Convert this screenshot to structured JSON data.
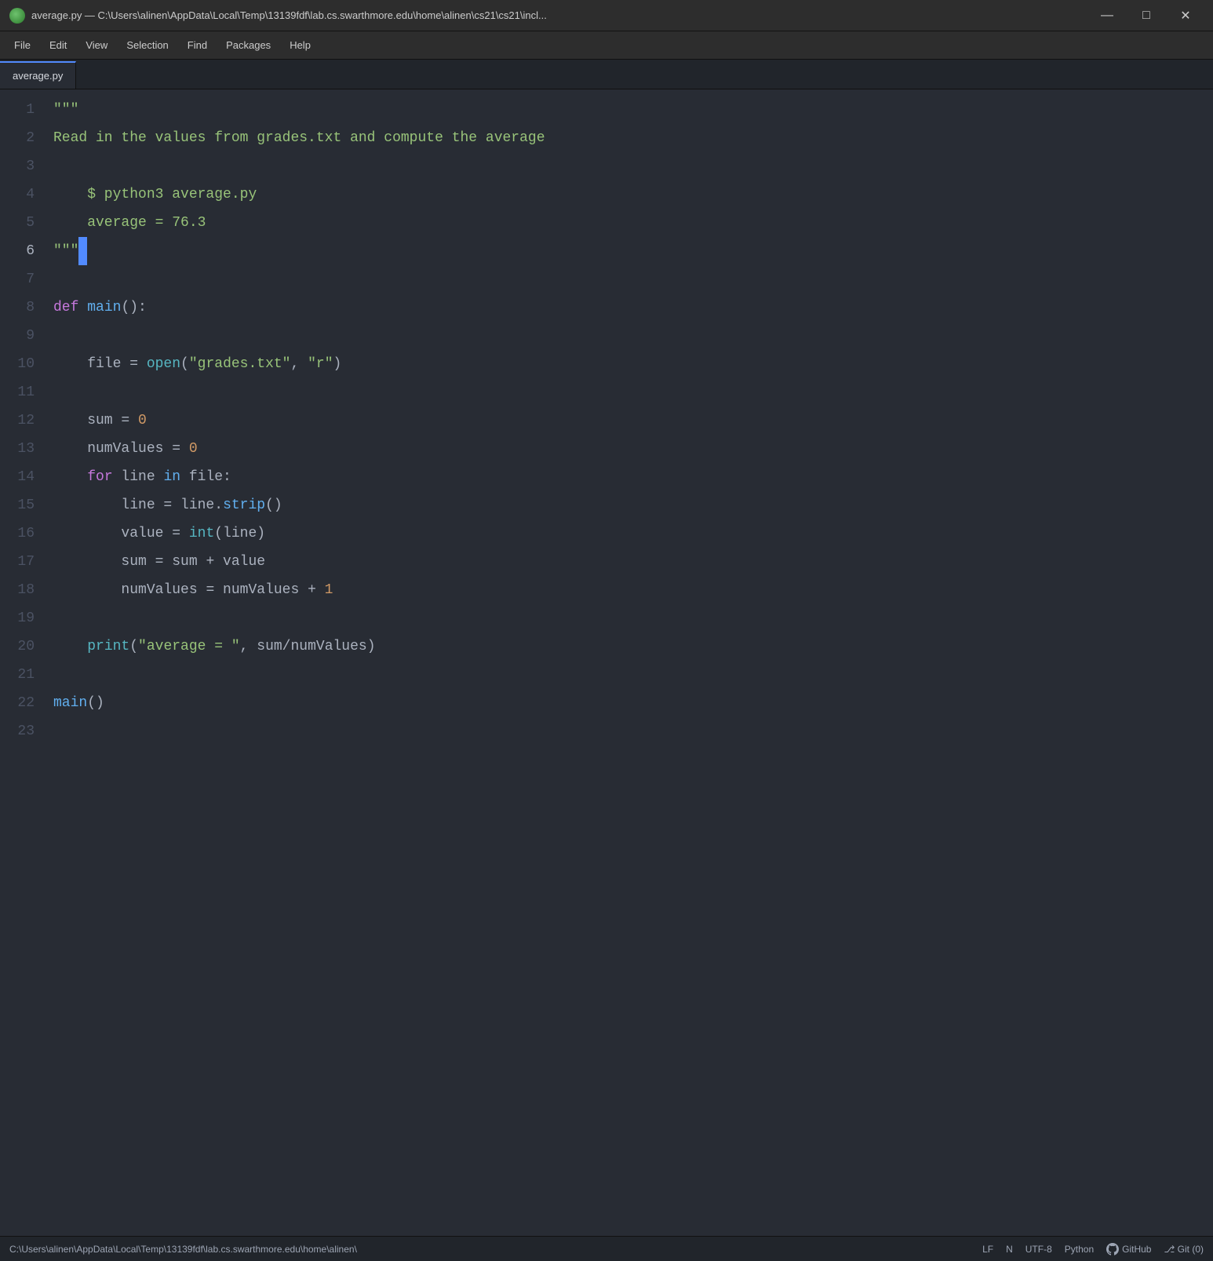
{
  "titlebar": {
    "title": "average.py — C:\\Users\\alinen\\AppData\\Local\\Temp\\13139fdf\\lab.cs.swarthmore.edu\\home\\alinen\\cs21\\cs21\\incl...",
    "minimize_label": "—",
    "maximize_label": "□",
    "close_label": "✕"
  },
  "menubar": {
    "items": [
      "File",
      "Edit",
      "View",
      "Selection",
      "Find",
      "Packages",
      "Help"
    ]
  },
  "tabs": [
    {
      "label": "average.py",
      "active": true
    }
  ],
  "code": {
    "lines": [
      {
        "num": 1,
        "tokens": [
          {
            "t": "\"\"\"",
            "c": "c-docstring"
          }
        ]
      },
      {
        "num": 2,
        "tokens": [
          {
            "t": "Read in ",
            "c": "c-docstring"
          },
          {
            "t": "the",
            "c": "c-docstring"
          },
          {
            "t": " values from grades.txt and compute the average",
            "c": "c-docstring"
          }
        ]
      },
      {
        "num": 3,
        "tokens": []
      },
      {
        "num": 4,
        "tokens": [
          {
            "t": "    $ python3 average.py",
            "c": "c-docstring"
          }
        ]
      },
      {
        "num": 5,
        "tokens": [
          {
            "t": "    average = 76.3",
            "c": "c-docstring"
          }
        ]
      },
      {
        "num": 6,
        "tokens": [
          {
            "t": "\"\"\"",
            "c": "c-docstring"
          },
          {
            "t": " ",
            "c": "cursor-char"
          }
        ]
      },
      {
        "num": 7,
        "tokens": []
      },
      {
        "num": 8,
        "tokens": [
          {
            "t": "def",
            "c": "c-keyword2"
          },
          {
            "t": " ",
            "c": "c-normal"
          },
          {
            "t": "main",
            "c": "c-func"
          },
          {
            "t": "():",
            "c": "c-normal"
          }
        ]
      },
      {
        "num": 9,
        "tokens": []
      },
      {
        "num": 10,
        "tokens": [
          {
            "t": "    file",
            "c": "c-normal"
          },
          {
            "t": " = ",
            "c": "c-normal"
          },
          {
            "t": "open",
            "c": "c-builtin"
          },
          {
            "t": "(",
            "c": "c-normal"
          },
          {
            "t": "\"grades.txt\"",
            "c": "c-string"
          },
          {
            "t": ", ",
            "c": "c-normal"
          },
          {
            "t": "\"r\"",
            "c": "c-string"
          },
          {
            "t": ")",
            "c": "c-normal"
          }
        ]
      },
      {
        "num": 11,
        "tokens": []
      },
      {
        "num": 12,
        "tokens": [
          {
            "t": "    sum",
            "c": "c-normal"
          },
          {
            "t": " = ",
            "c": "c-normal"
          },
          {
            "t": "0",
            "c": "c-number"
          }
        ]
      },
      {
        "num": 13,
        "tokens": [
          {
            "t": "    numValues",
            "c": "c-normal"
          },
          {
            "t": " = ",
            "c": "c-normal"
          },
          {
            "t": "0",
            "c": "c-number"
          }
        ]
      },
      {
        "num": 14,
        "tokens": [
          {
            "t": "    ",
            "c": "c-normal"
          },
          {
            "t": "for",
            "c": "c-keyword2"
          },
          {
            "t": " line ",
            "c": "c-normal"
          },
          {
            "t": "in",
            "c": "c-keyword"
          },
          {
            "t": " file:",
            "c": "c-normal"
          }
        ]
      },
      {
        "num": 15,
        "tokens": [
          {
            "t": "        line",
            "c": "c-normal"
          },
          {
            "t": " = ",
            "c": "c-normal"
          },
          {
            "t": "line",
            "c": "c-normal"
          },
          {
            "t": ".",
            "c": "c-normal"
          },
          {
            "t": "strip",
            "c": "c-method"
          },
          {
            "t": "()",
            "c": "c-normal"
          }
        ]
      },
      {
        "num": 16,
        "tokens": [
          {
            "t": "        value",
            "c": "c-normal"
          },
          {
            "t": " = ",
            "c": "c-normal"
          },
          {
            "t": "int",
            "c": "c-builtin"
          },
          {
            "t": "(line)",
            "c": "c-normal"
          }
        ]
      },
      {
        "num": 17,
        "tokens": [
          {
            "t": "        sum",
            "c": "c-normal"
          },
          {
            "t": " = sum + value",
            "c": "c-normal"
          }
        ]
      },
      {
        "num": 18,
        "tokens": [
          {
            "t": "        numValues",
            "c": "c-normal"
          },
          {
            "t": " = numValues + ",
            "c": "c-normal"
          },
          {
            "t": "1",
            "c": "c-number"
          }
        ]
      },
      {
        "num": 19,
        "tokens": []
      },
      {
        "num": 20,
        "tokens": [
          {
            "t": "    ",
            "c": "c-normal"
          },
          {
            "t": "print",
            "c": "c-builtin"
          },
          {
            "t": "(",
            "c": "c-normal"
          },
          {
            "t": "\"average = \"",
            "c": "c-string"
          },
          {
            "t": ", sum/numValues)",
            "c": "c-normal"
          }
        ]
      },
      {
        "num": 21,
        "tokens": []
      },
      {
        "num": 22,
        "tokens": [
          {
            "t": "main",
            "c": "c-func"
          },
          {
            "t": "()",
            "c": "c-normal"
          }
        ]
      },
      {
        "num": 23,
        "tokens": []
      }
    ]
  },
  "statusbar": {
    "path": "C:\\Users\\alinen\\AppData\\Local\\Temp\\13139fdf\\lab.cs.swarthmore.edu\\home\\alinen\\",
    "line_ending": "LF",
    "indent": "N",
    "encoding": "UTF-8",
    "language": "Python",
    "github_label": "GitHub",
    "git_label": "Git (0)"
  }
}
